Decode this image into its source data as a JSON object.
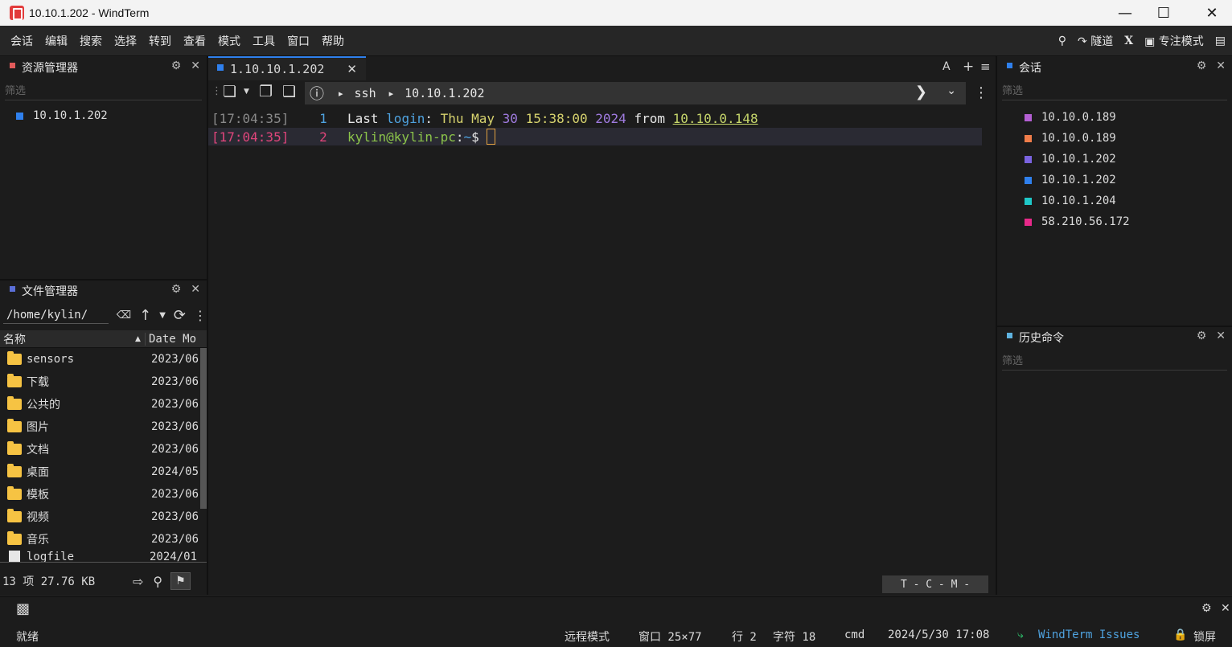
{
  "window": {
    "title": "10.10.1.202 - WindTerm",
    "minimize": "—",
    "maximize": "☐",
    "close": "✕"
  },
  "menu": {
    "items": [
      "会话",
      "编辑",
      "搜索",
      "选择",
      "转到",
      "查看",
      "模式",
      "工具",
      "窗口",
      "帮助"
    ],
    "tunnel": "隧道",
    "x_label": "X",
    "focus_mode": "专注模式"
  },
  "explorer": {
    "title": "资源管理器",
    "filter_placeholder": "筛选",
    "items": [
      {
        "label": "10.10.1.202",
        "color": "#2f80ed"
      }
    ]
  },
  "file_manager": {
    "title": "文件管理器",
    "path": "/home/kylin/",
    "columns": {
      "name": "名称",
      "date": "Date Mo"
    },
    "rows": [
      {
        "name": "sensors",
        "date": "2023/06",
        "type": "folder"
      },
      {
        "name": "下载",
        "date": "2023/06",
        "type": "folder"
      },
      {
        "name": "公共的",
        "date": "2023/06",
        "type": "folder"
      },
      {
        "name": "图片",
        "date": "2023/06",
        "type": "folder"
      },
      {
        "name": "文档",
        "date": "2023/06",
        "type": "folder"
      },
      {
        "name": "桌面",
        "date": "2024/05",
        "type": "folder"
      },
      {
        "name": "模板",
        "date": "2023/06",
        "type": "folder"
      },
      {
        "name": "视频",
        "date": "2023/06",
        "type": "folder"
      },
      {
        "name": "音乐",
        "date": "2023/06",
        "type": "folder"
      },
      {
        "name": "logfile",
        "date": "2024/01",
        "type": "file"
      }
    ],
    "summary": "13 项 27.76 KB"
  },
  "tab": {
    "label": "1.10.10.1.202",
    "font_button": "A",
    "add_button": "+",
    "menu_button": "≡"
  },
  "address": {
    "arrow1": "▸",
    "protocol": "ssh",
    "arrow2": "▸",
    "host": "10.10.1.202"
  },
  "terminal": {
    "lines": [
      {
        "time": "[17:04:35]",
        "num": "1",
        "segments": [
          {
            "text": "Last ",
            "color": "#e8e8e8"
          },
          {
            "text": "login",
            "color": "#4fa3e0"
          },
          {
            "text": ": ",
            "color": "#e8e8e8"
          },
          {
            "text": "Thu May ",
            "color": "#d7d36e"
          },
          {
            "text": "30 ",
            "color": "#a07be0"
          },
          {
            "text": "15:38:00 ",
            "color": "#d7d36e"
          },
          {
            "text": "2024 ",
            "color": "#a07be0"
          },
          {
            "text": "from ",
            "color": "#e8e8e8"
          },
          {
            "text": "10.10.0.148",
            "color": "#c6d66b"
          }
        ]
      },
      {
        "time": "[17:04:35]",
        "num": "2",
        "segments": [
          {
            "text": "kylin@kylin-pc",
            "color": "#8bc34a"
          },
          {
            "text": ":",
            "color": "#e8e8e8"
          },
          {
            "text": "~",
            "color": "#4fa3e0"
          },
          {
            "text": "$ ",
            "color": "#e8e8e8"
          }
        ]
      }
    ],
    "status_indicator": "T - C - M -"
  },
  "sessions": {
    "title": "会话",
    "filter_placeholder": "筛选",
    "items": [
      {
        "label": "10.10.0.189",
        "color": "#b45fd3"
      },
      {
        "label": "10.10.0.189",
        "color": "#f07d4a"
      },
      {
        "label": "10.10.1.202",
        "color": "#7a63e0"
      },
      {
        "label": "10.10.1.202",
        "color": "#2f80ed"
      },
      {
        "label": "10.10.1.204",
        "color": "#1fc8c8"
      },
      {
        "label": "58.210.56.172",
        "color": "#e8298a"
      }
    ]
  },
  "history": {
    "title": "历史命令",
    "filter_placeholder": "筛选"
  },
  "status": {
    "ready": "就绪",
    "mode": "远程模式",
    "window_size": "窗口 25×77",
    "row": "行 2",
    "char": "字符 18",
    "shell": "cmd",
    "datetime": "2024/5/30 17:08",
    "issues": "WindTerm Issues",
    "lock": "锁屏"
  }
}
